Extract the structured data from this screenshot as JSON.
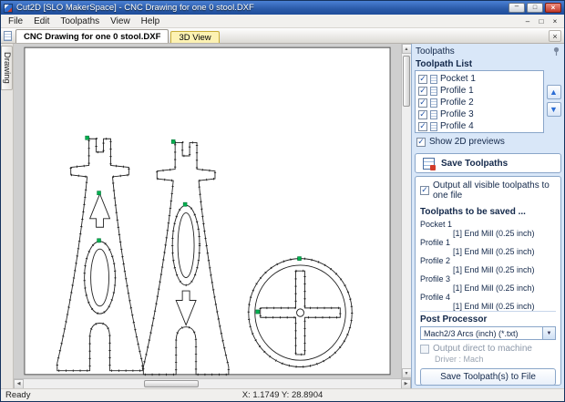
{
  "window": {
    "title": "Cut2D [SLO MakerSpace] - CNC Drawing for one 0 stool.DXF"
  },
  "menu": {
    "items": [
      {
        "label": "File"
      },
      {
        "label": "Edit"
      },
      {
        "label": "Toolpaths"
      },
      {
        "label": "View"
      },
      {
        "label": "Help"
      }
    ]
  },
  "tabs": {
    "drawing_tab": "CNC Drawing for one 0 stool.DXF",
    "view3d_tab": "3D View"
  },
  "side_tab_label": "Drawing",
  "panel": {
    "title": "Toolpaths",
    "list_title": "Toolpath List",
    "items": [
      {
        "label": "Pocket 1"
      },
      {
        "label": "Profile 1"
      },
      {
        "label": "Profile 2"
      },
      {
        "label": "Profile 3"
      },
      {
        "label": "Profile 4"
      }
    ],
    "show_previews_label": "Show 2D previews",
    "save": {
      "header": "Save Toolpaths",
      "output_all_label": "Output all visible toolpaths to one file",
      "to_be_saved_title": "Toolpaths to be saved ...",
      "entries": [
        {
          "name": "Pocket 1",
          "tool": "[1] End Mill (0.25 inch)"
        },
        {
          "name": "Profile 1",
          "tool": "[1] End Mill (0.25 inch)"
        },
        {
          "name": "Profile 2",
          "tool": "[1] End Mill (0.25 inch)"
        },
        {
          "name": "Profile 3",
          "tool": "[1] End Mill (0.25 inch)"
        },
        {
          "name": "Profile 4",
          "tool": "[1] End Mill (0.25 inch)"
        }
      ],
      "post_processor_label": "Post Processor",
      "post_processor_value": "Mach2/3 Arcs (inch) (*.txt)",
      "output_direct_label": "Output direct to machine",
      "driver_label": "Driver : Mach",
      "save_button_label": "Save Toolpath(s) to File"
    }
  },
  "status": {
    "left": "Ready",
    "coords": "X: 1.1749 Y: 28.8904"
  },
  "colors": {
    "titlebar_blue": "#2a5aa8",
    "panel_blue": "#d9e7f8",
    "tab_yellow": "#fdf2b3",
    "check_blue": "#2456a8",
    "start_point_green": "#00b050"
  }
}
